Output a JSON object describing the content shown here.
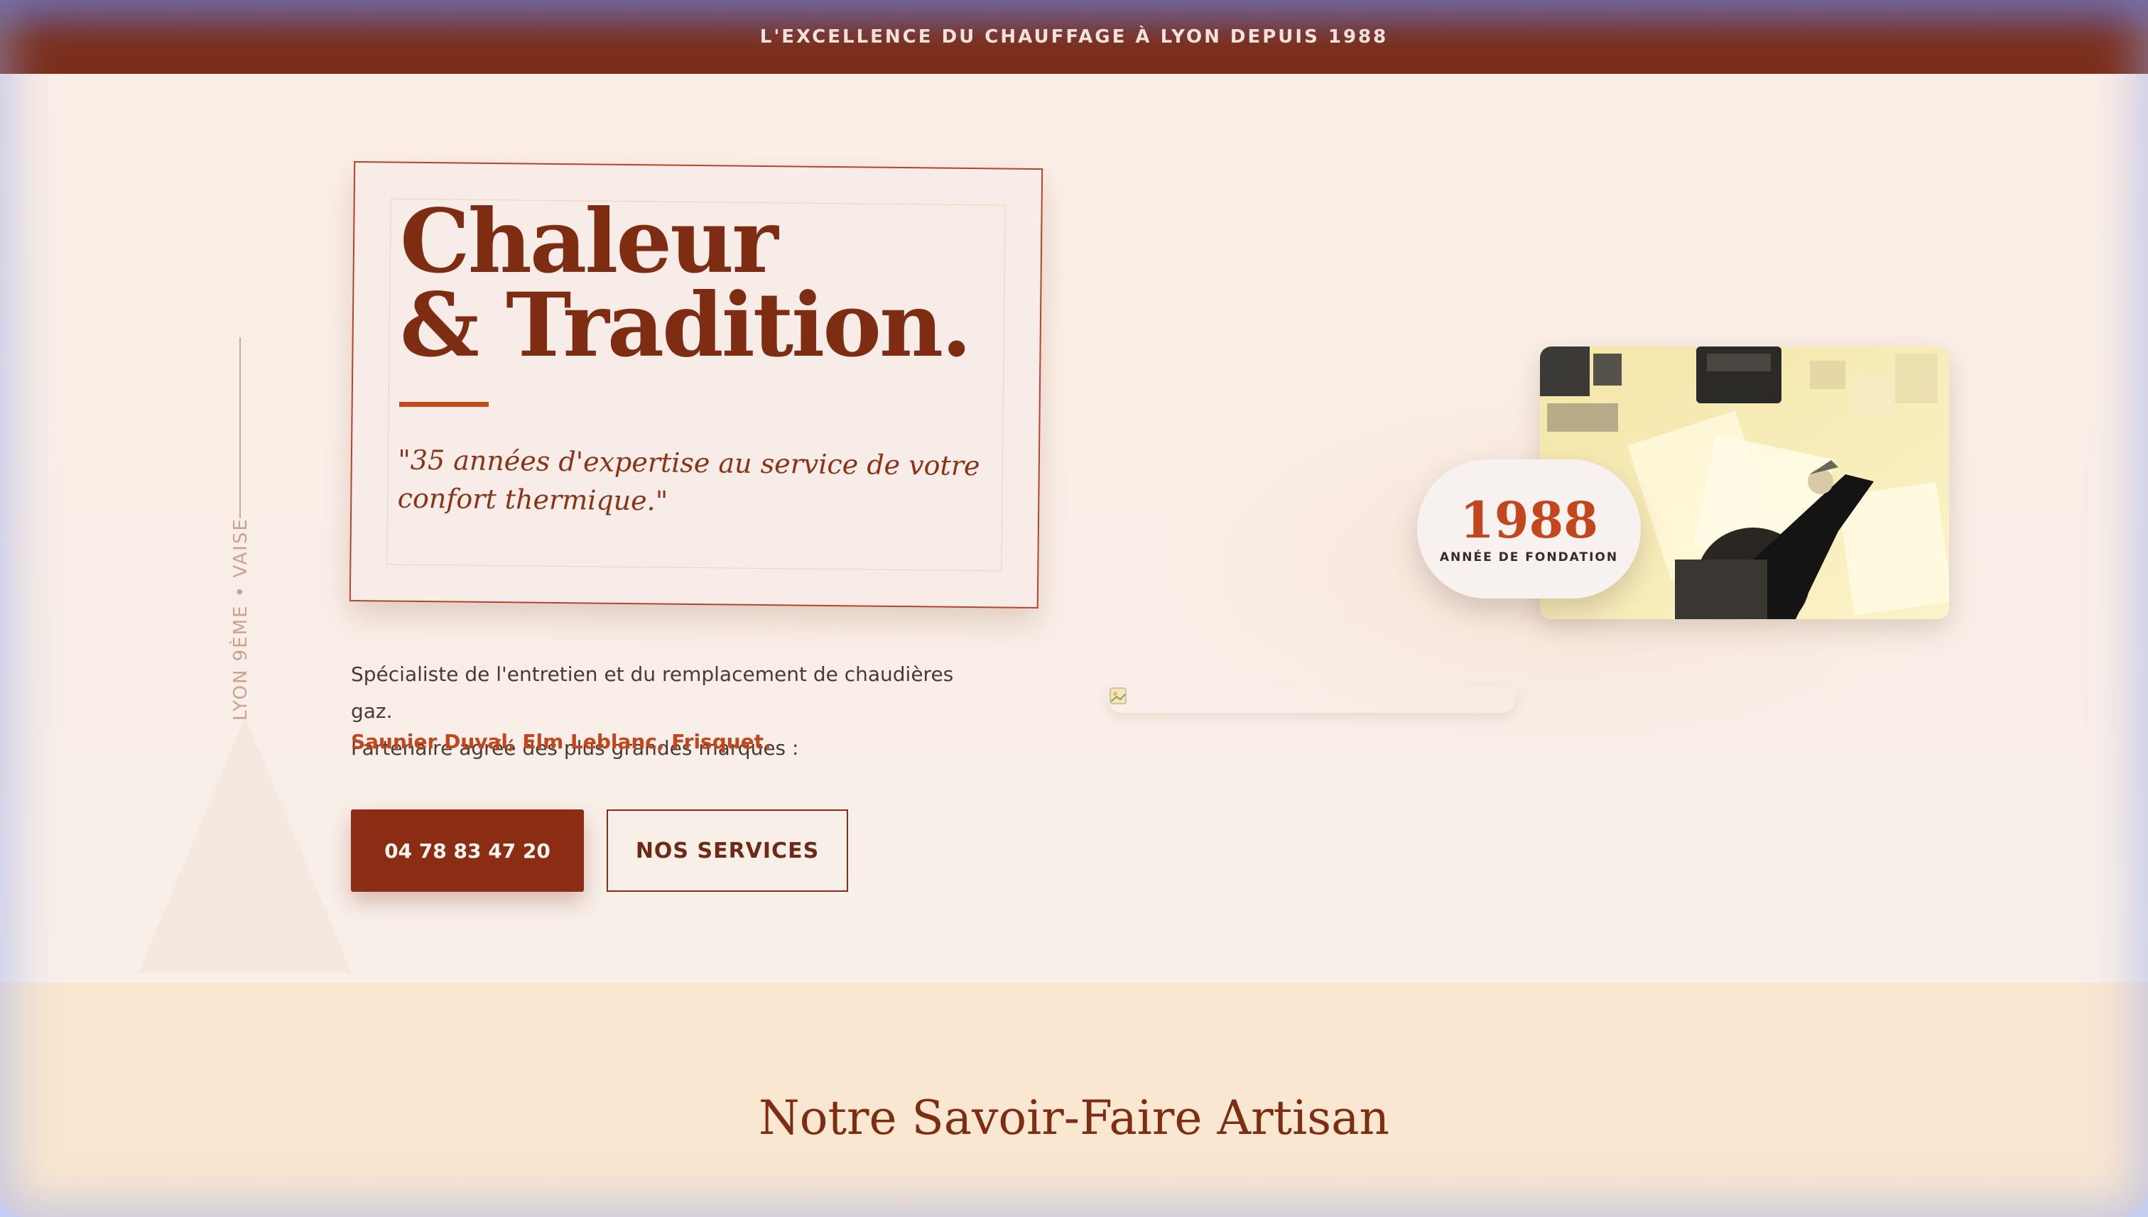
{
  "banner": {
    "text": "L'EXCELLENCE DU CHAUFFAGE À LYON DEPUIS 1988"
  },
  "hero": {
    "side_text": "LYON 9ÈME • VAISE",
    "title_line1": "Chaleur",
    "title_line2": "& Tradition.",
    "quote": "\"35 années d'expertise au service de votre confort thermique.\"",
    "description_line1": "Spécialiste de l'entretien et du remplacement de chaudières gaz.",
    "description_line2": "Partenaire agréé des plus grandes marques :",
    "brands": "Saunier Duval, Elm Leblanc, Frisquet.",
    "phone_button": "04 78 83 47 20",
    "services_button": "NOS SERVICES",
    "badge_year": "1988",
    "badge_label": "ANNÉE DE FONDATION"
  },
  "section2": {
    "heading": "Notre Savoir-Faire Artisan"
  },
  "colors": {
    "accent": "#c4461c",
    "brand_dark": "#7f2d12",
    "banner_bg": "#7c2e1a",
    "page_bg": "#faeee5",
    "section_bg": "#fae7d1"
  },
  "icons": {
    "broken_image": "broken-image-icon"
  }
}
